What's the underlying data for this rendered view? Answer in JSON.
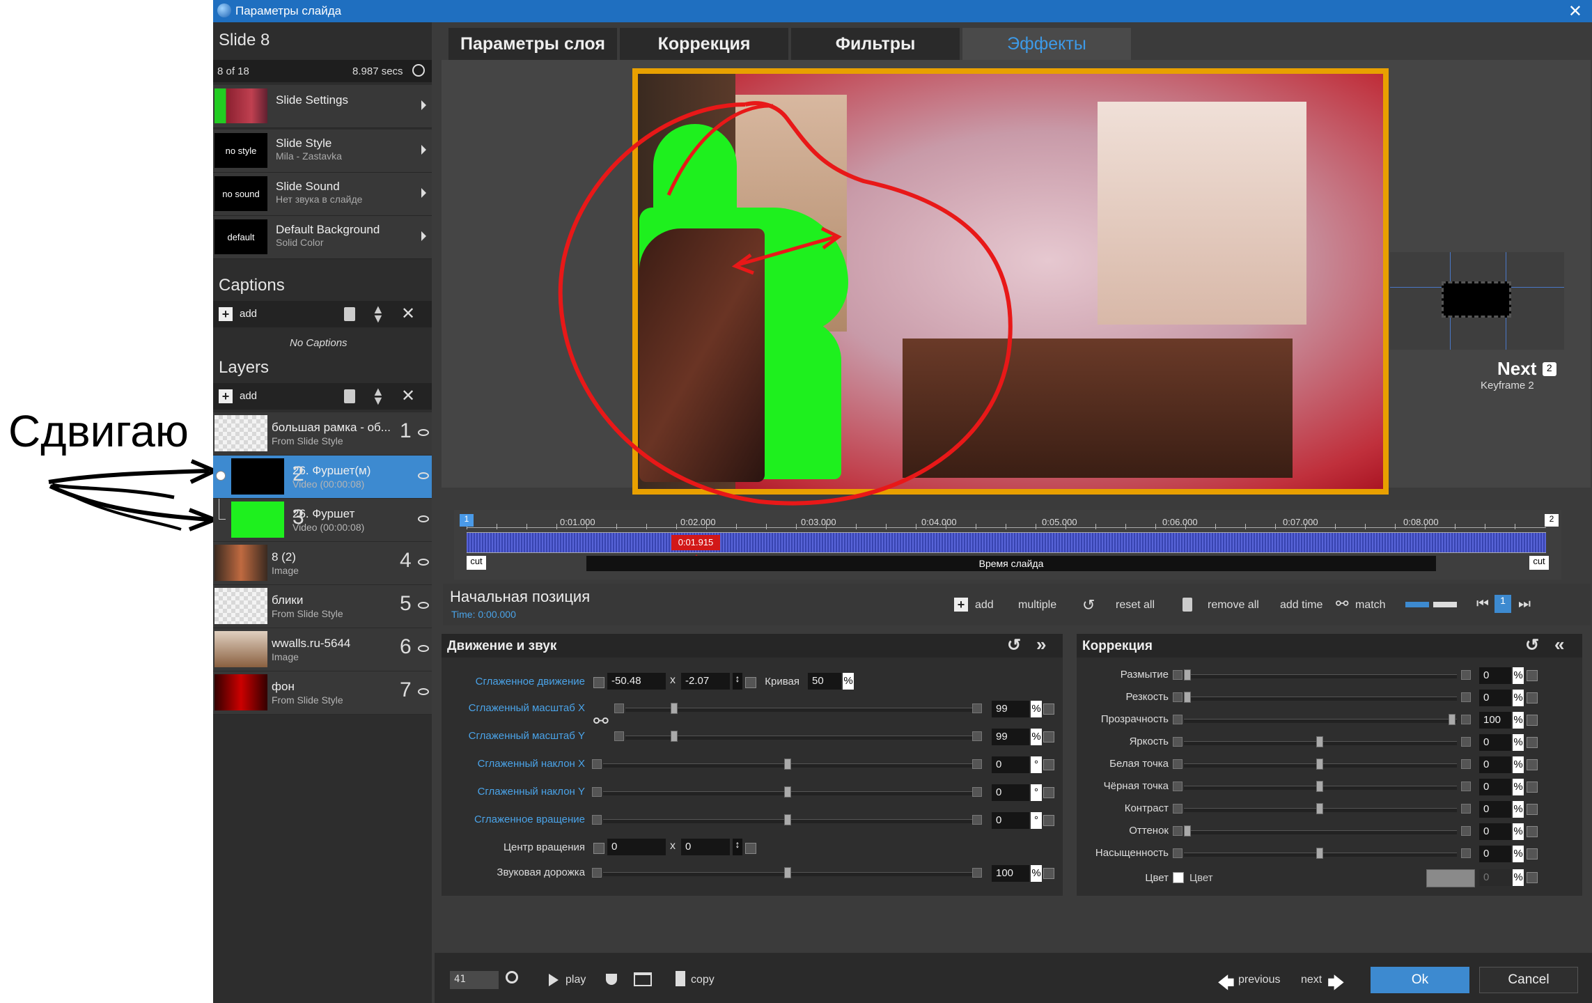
{
  "window": {
    "title": "Параметры слайда",
    "close": "✕"
  },
  "annotation": {
    "text": "Сдвигаю"
  },
  "slide": {
    "name": "Slide 8",
    "position": "8 of 18",
    "duration": "8.987 secs"
  },
  "slide_items": [
    {
      "thumb": "",
      "label": "Slide Settings",
      "sub": ""
    },
    {
      "thumb": "no style",
      "label": "Slide Style",
      "sub": "Mila - Zastavka"
    },
    {
      "thumb": "no sound",
      "label": "Slide Sound",
      "sub": "Нет звука в слайде"
    },
    {
      "thumb": "default",
      "label": "Default Background",
      "sub": "Solid Color"
    }
  ],
  "captions": {
    "title": "Captions",
    "add": "add",
    "empty": "No Captions"
  },
  "layers": {
    "title": "Layers",
    "add": "add",
    "items": [
      {
        "label": "большая рамка - об...",
        "sub": "From Slide Style",
        "num": "1"
      },
      {
        "label": "26. Фуршет(м)",
        "sub": "Video (00:00:08)",
        "num": "2"
      },
      {
        "label": "26. Фуршет",
        "sub": "Video (00:00:08)",
        "num": "3"
      },
      {
        "label": "8 (2)",
        "sub": "Image",
        "num": "4"
      },
      {
        "label": "блики",
        "sub": "From Slide Style",
        "num": "5"
      },
      {
        "label": "wwalls.ru-5644",
        "sub": "Image",
        "num": "6"
      },
      {
        "label": "фон",
        "sub": "From Slide Style",
        "num": "7"
      }
    ]
  },
  "tabs": [
    "Параметры слоя",
    "Коррекция",
    "Фильтры",
    "Эффекты"
  ],
  "next": {
    "label": "Next",
    "badge": "2",
    "sub": "Keyframe 2"
  },
  "timeline": {
    "ticks": [
      "0:01.000",
      "0:02.000",
      "0:03.000",
      "0:04.000",
      "0:05.000",
      "0:06.000",
      "0:07.000",
      "0:08.000"
    ],
    "current": "0:01.915",
    "bar_label": "Время слайда",
    "cut": "cut",
    "kf1": "1",
    "kf2": "2"
  },
  "keyframe": {
    "title": "Начальная позиция",
    "time": "Time: 0:00.000"
  },
  "kf_toolbar": {
    "add": "add",
    "multiple": "multiple",
    "reset_all": "reset all",
    "remove_all": "remove all",
    "add_time": "add time",
    "match": "match"
  },
  "motion": {
    "title": "Движение и звук",
    "pan_label": "Сглаженное движение",
    "pan_x": "-50.48",
    "pan_x_sep": "x",
    "pan_y": "-2.07",
    "curve_label": "Кривая",
    "curve_val": "50",
    "zoom_x_label": "Сглаженный масштаб X",
    "zoom_x": "99",
    "zoom_y_label": "Сглаженный масштаб Y",
    "zoom_y": "99",
    "tilt_x_label": "Сглаженный наклон X",
    "tilt_x": "0",
    "tilt_y_label": "Сглаженный наклон Y",
    "tilt_y": "0",
    "rot_label": "Сглаженное вращение",
    "rot": "0",
    "center_label": "Центр вращения",
    "center_x": "0",
    "center_y": "0",
    "audio_label": "Звуковая дорожка",
    "audio": "100",
    "pct": "%",
    "deg": "°"
  },
  "correction": {
    "title": "Коррекция",
    "rows": [
      {
        "label": "Размытие",
        "value": "0",
        "knob": 0
      },
      {
        "label": "Резкость",
        "value": "0",
        "knob": 0
      },
      {
        "label": "Прозрачность",
        "value": "100",
        "knob": 1
      },
      {
        "label": "Яркость",
        "value": "0",
        "knob": 0.5
      },
      {
        "label": "Белая точка",
        "value": "0",
        "knob": 0.5
      },
      {
        "label": "Чёрная точка",
        "value": "0",
        "knob": 0.5
      },
      {
        "label": "Контраст",
        "value": "0",
        "knob": 0.5
      },
      {
        "label": "Оттенок",
        "value": "0",
        "knob": 0
      },
      {
        "label": "Насыщенность",
        "value": "0",
        "knob": 0.5
      }
    ],
    "color_label": "Цвет",
    "color_check": "Цвет",
    "color_val": "0",
    "pct": "%"
  },
  "bottom": {
    "search": "41",
    "play": "play",
    "copy": "copy",
    "previous": "previous",
    "next": "next",
    "ok": "Ok",
    "cancel": "Cancel"
  }
}
